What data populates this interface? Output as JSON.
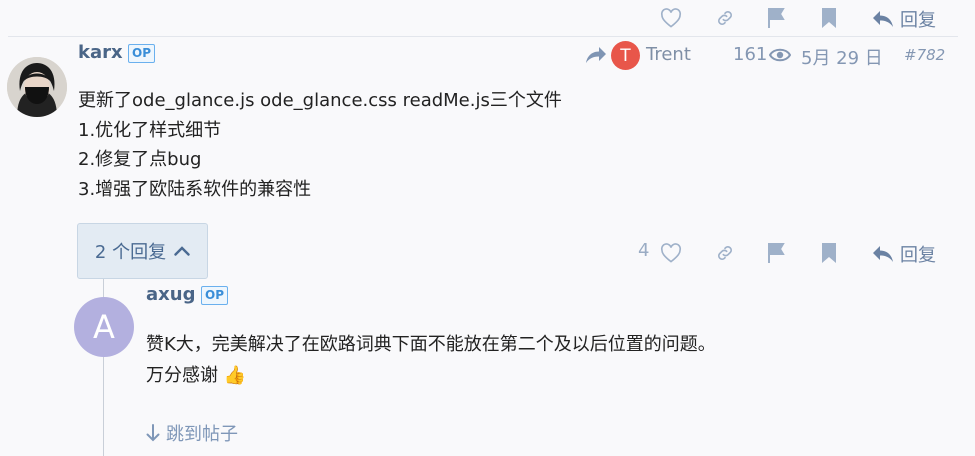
{
  "top_actions": {
    "reply_label": "回复"
  },
  "post": {
    "username": "karx",
    "op_badge": "OP",
    "reply_to_name": "Trent",
    "reply_to_initial": "T",
    "views": "161",
    "date": "5月 29 日",
    "post_number": "#782",
    "lines": [
      "更新了ode_glance.js ode_glance.css readMe.js三个文件",
      "1.优化了样式细节",
      "2.修复了点bug",
      "3.增强了欧陆系软件的兼容性"
    ],
    "replies_toggle": "2 个回复",
    "likes": "4",
    "reply_label": "回复"
  },
  "reply": {
    "username": "axug",
    "op_badge": "OP",
    "avatar_initial": "A",
    "lines": [
      "赞K大，完美解决了在欧路词典下面不能放在第二个及以后位置的问题。",
      "万分感谢 👍"
    ],
    "jump_label": "跳到帖子"
  },
  "colors": {
    "accent": "#4a6587",
    "icon": "#8fa2bd",
    "op": "#3a8ed8",
    "trent": "#e8564a",
    "axug_avatar": "#b3b0df"
  }
}
